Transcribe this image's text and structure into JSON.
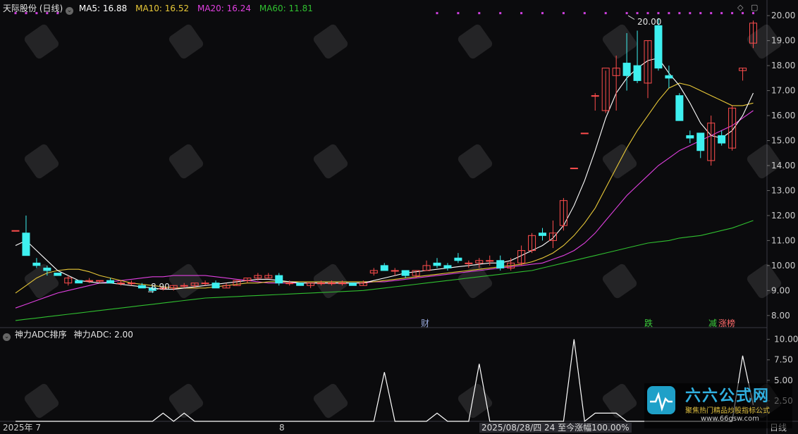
{
  "header": {
    "title": "天际股份 (日线)",
    "ma5": "MA5: 16.88",
    "ma10": "MA10: 16.52",
    "ma20": "MA20: 16.24",
    "ma60": "MA60: 11.81"
  },
  "sub_header": {
    "title": "神力ADC排序",
    "value": "神力ADC: 2.00"
  },
  "annotations": {
    "high_label": "20.00",
    "low_label": "8.90",
    "marker_cai": "财",
    "marker_die": "跌",
    "marker_jian": "减",
    "marker_zhangbang": "涨榜"
  },
  "footer": {
    "x_start": "2025年 7",
    "x_mid": "8",
    "status": "2025/08/28/四 24 至今涨幅100.00%",
    "period": "日线"
  },
  "watermark": {
    "brand": "六六公式网",
    "slogan": "聚焦热门精品炒股指标公式",
    "url": "www.66gsw.com"
  },
  "colors": {
    "up": "#ff4d4d",
    "down": "#3ef0f0",
    "ma5": "#ffffff",
    "ma10": "#e8c838",
    "ma20": "#e040e0",
    "ma60": "#30c030",
    "background": "#0b0b0d"
  },
  "chart_data": [
    {
      "type": "candlestick",
      "title": "天际股份 (日线)",
      "ylim": [
        7.6,
        20.4
      ],
      "yticks": [
        "20.00",
        "19.00",
        "18.00",
        "17.00",
        "16.00",
        "15.00",
        "14.00",
        "13.00",
        "12.00",
        "11.00",
        "10.00",
        "9.00",
        "8.00"
      ],
      "candles": [
        [
          11.4,
          11.4,
          11.4,
          11.4
        ],
        [
          11.3,
          12.0,
          10.5,
          10.4
        ],
        [
          10.1,
          10.3,
          9.9,
          10.0
        ],
        [
          9.9,
          10.0,
          9.6,
          9.8
        ],
        [
          9.7,
          9.7,
          9.6,
          9.6
        ],
        [
          9.3,
          9.6,
          9.2,
          9.5
        ],
        [
          9.4,
          9.4,
          9.3,
          9.3
        ],
        [
          9.4,
          9.5,
          9.3,
          9.4
        ],
        [
          9.4,
          9.4,
          9.3,
          9.4
        ],
        [
          9.4,
          9.5,
          9.3,
          9.3
        ],
        [
          9.3,
          9.4,
          9.2,
          9.3
        ],
        [
          9.3,
          9.4,
          9.2,
          9.3
        ],
        [
          9.2,
          9.3,
          9.1,
          9.1
        ],
        [
          9.1,
          9.2,
          8.9,
          9.0
        ],
        [
          9.1,
          9.2,
          9.0,
          9.1
        ],
        [
          9.1,
          9.2,
          9.0,
          9.2
        ],
        [
          9.2,
          9.3,
          9.1,
          9.2
        ],
        [
          9.2,
          9.3,
          9.1,
          9.3
        ],
        [
          9.3,
          9.4,
          9.2,
          9.3
        ],
        [
          9.3,
          9.4,
          9.1,
          9.1
        ],
        [
          9.1,
          9.3,
          9.1,
          9.2
        ],
        [
          9.2,
          9.4,
          9.2,
          9.4
        ],
        [
          9.4,
          9.5,
          9.3,
          9.5
        ],
        [
          9.5,
          9.7,
          9.4,
          9.6
        ],
        [
          9.5,
          9.7,
          9.5,
          9.6
        ],
        [
          9.6,
          9.7,
          9.2,
          9.3
        ],
        [
          9.3,
          9.4,
          9.2,
          9.3
        ],
        [
          9.3,
          9.3,
          9.2,
          9.2
        ],
        [
          9.2,
          9.3,
          9.1,
          9.3
        ],
        [
          9.3,
          9.4,
          9.2,
          9.3
        ],
        [
          9.3,
          9.4,
          9.2,
          9.3
        ],
        [
          9.3,
          9.4,
          9.2,
          9.3
        ],
        [
          9.3,
          9.3,
          9.2,
          9.2
        ],
        [
          9.2,
          9.4,
          9.2,
          9.3
        ],
        [
          9.7,
          9.9,
          9.6,
          9.8
        ],
        [
          10.0,
          10.1,
          9.8,
          9.8
        ],
        [
          9.8,
          9.9,
          9.6,
          9.8
        ],
        [
          9.8,
          9.8,
          9.5,
          9.6
        ],
        [
          9.6,
          9.8,
          9.5,
          9.8
        ],
        [
          9.8,
          10.2,
          9.8,
          10.0
        ],
        [
          10.1,
          10.3,
          9.9,
          10.0
        ],
        [
          10.0,
          10.1,
          9.8,
          9.9
        ],
        [
          10.3,
          10.5,
          10.1,
          10.2
        ],
        [
          10.1,
          10.2,
          9.9,
          10.1
        ],
        [
          10.1,
          10.3,
          9.9,
          10.2
        ],
        [
          10.2,
          10.4,
          10.0,
          10.2
        ],
        [
          10.2,
          10.4,
          9.8,
          9.9
        ],
        [
          9.9,
          10.3,
          9.8,
          10.1
        ],
        [
          10.1,
          10.8,
          10.0,
          10.6
        ],
        [
          10.6,
          11.3,
          10.5,
          11.2
        ],
        [
          11.3,
          11.5,
          11.0,
          11.2
        ],
        [
          11.0,
          11.8,
          10.7,
          11.3
        ],
        [
          11.6,
          12.7,
          11.4,
          12.6
        ],
        [
          13.9,
          13.9,
          13.9,
          13.9
        ],
        [
          15.3,
          15.3,
          15.3,
          15.3
        ],
        [
          16.8,
          16.9,
          16.2,
          16.8
        ],
        [
          16.2,
          17.8,
          16.1,
          17.9
        ],
        [
          17.6,
          18.4,
          16.2,
          17.9
        ],
        [
          18.1,
          19.3,
          17.0,
          17.6
        ],
        [
          18.0,
          19.4,
          17.3,
          17.4
        ],
        [
          17.3,
          19.0,
          16.7,
          19.0
        ],
        [
          19.6,
          19.9,
          17.8,
          17.9
        ],
        [
          17.6,
          18.0,
          17.1,
          17.5
        ],
        [
          16.8,
          16.9,
          15.8,
          15.8
        ],
        [
          15.2,
          15.4,
          14.9,
          15.1
        ],
        [
          15.3,
          15.3,
          14.3,
          14.6
        ],
        [
          14.2,
          16.0,
          14.0,
          15.7
        ],
        [
          15.2,
          15.4,
          14.8,
          14.9
        ],
        [
          14.7,
          16.4,
          14.6,
          16.3
        ],
        [
          17.8,
          17.9,
          17.4,
          17.9
        ],
        [
          18.9,
          19.8,
          18.7,
          19.7
        ]
      ],
      "ma5": [
        10.8,
        11.0,
        10.6,
        10.2,
        9.8,
        9.6,
        9.4,
        9.35,
        9.3,
        9.3,
        9.25,
        9.2,
        9.15,
        9.1,
        9.05,
        9.05,
        9.1,
        9.15,
        9.2,
        9.25,
        9.3,
        9.35,
        9.4,
        9.45,
        9.45,
        9.4,
        9.35,
        9.3,
        9.3,
        9.3,
        9.3,
        9.3,
        9.3,
        9.3,
        9.4,
        9.5,
        9.6,
        9.7,
        9.75,
        9.8,
        9.85,
        9.9,
        9.95,
        10.0,
        10.05,
        10.1,
        10.1,
        10.2,
        10.4,
        10.6,
        10.8,
        11.1,
        11.6,
        12.4,
        13.4,
        14.6,
        15.9,
        16.9,
        17.5,
        17.9,
        18.2,
        18.3,
        17.7,
        17.2,
        16.5,
        15.7,
        15.2,
        15.1,
        15.4,
        16.0,
        16.9
      ],
      "ma10": [
        8.9,
        9.2,
        9.5,
        9.7,
        9.8,
        9.85,
        9.85,
        9.75,
        9.6,
        9.5,
        9.4,
        9.3,
        9.25,
        9.2,
        9.15,
        9.1,
        9.1,
        9.1,
        9.1,
        9.15,
        9.2,
        9.25,
        9.3,
        9.3,
        9.35,
        9.35,
        9.35,
        9.35,
        9.35,
        9.35,
        9.35,
        9.35,
        9.35,
        9.35,
        9.35,
        9.4,
        9.45,
        9.5,
        9.55,
        9.6,
        9.65,
        9.7,
        9.75,
        9.8,
        9.85,
        9.9,
        9.95,
        10.0,
        10.05,
        10.15,
        10.3,
        10.5,
        10.8,
        11.2,
        11.7,
        12.3,
        13.1,
        13.9,
        14.7,
        15.4,
        16.0,
        16.6,
        17.1,
        17.3,
        17.2,
        17.0,
        16.8,
        16.6,
        16.4,
        16.4,
        16.5
      ],
      "ma20": [
        8.3,
        8.45,
        8.6,
        8.75,
        8.9,
        9.0,
        9.1,
        9.2,
        9.3,
        9.35,
        9.4,
        9.45,
        9.5,
        9.55,
        9.55,
        9.6,
        9.6,
        9.6,
        9.6,
        9.55,
        9.5,
        9.45,
        9.4,
        9.35,
        9.3,
        9.3,
        9.3,
        9.3,
        9.3,
        9.3,
        9.3,
        9.3,
        9.3,
        9.3,
        9.35,
        9.35,
        9.4,
        9.45,
        9.5,
        9.55,
        9.6,
        9.65,
        9.7,
        9.75,
        9.8,
        9.85,
        9.9,
        9.95,
        10.0,
        10.05,
        10.1,
        10.25,
        10.4,
        10.6,
        10.9,
        11.3,
        11.8,
        12.3,
        12.8,
        13.2,
        13.6,
        14.0,
        14.3,
        14.6,
        14.8,
        15.0,
        15.2,
        15.4,
        15.6,
        15.9,
        16.2
      ],
      "ma60": [
        7.8,
        7.85,
        7.9,
        7.95,
        8.0,
        8.05,
        8.1,
        8.15,
        8.2,
        8.25,
        8.3,
        8.35,
        8.4,
        8.45,
        8.5,
        8.55,
        8.6,
        8.65,
        8.7,
        8.72,
        8.74,
        8.76,
        8.78,
        8.8,
        8.82,
        8.84,
        8.86,
        8.88,
        8.9,
        8.92,
        8.94,
        8.96,
        8.98,
        9.0,
        9.05,
        9.1,
        9.15,
        9.2,
        9.25,
        9.3,
        9.35,
        9.4,
        9.45,
        9.5,
        9.55,
        9.6,
        9.65,
        9.7,
        9.75,
        9.8,
        9.9,
        10.0,
        10.1,
        10.2,
        10.3,
        10.4,
        10.5,
        10.6,
        10.7,
        10.8,
        10.9,
        10.95,
        11.0,
        11.1,
        11.15,
        11.2,
        11.3,
        11.4,
        11.5,
        11.65,
        11.8
      ],
      "signal_dots_price": 20.1
    },
    {
      "type": "line",
      "title": "神力ADC排序",
      "ylim": [
        0,
        11
      ],
      "yticks": [
        "10.00",
        "7.50",
        "5.00",
        "2.50"
      ],
      "series": [
        {
          "name": "神力ADC",
          "values": [
            0,
            0,
            0,
            0,
            0,
            0,
            0,
            0,
            0,
            0,
            0,
            0,
            0,
            0,
            1,
            0,
            1,
            0,
            0,
            0,
            0,
            0,
            0,
            0,
            0,
            0,
            0,
            0,
            0,
            0,
            0,
            0,
            0,
            0,
            0,
            6,
            0,
            0,
            0,
            0,
            1,
            0,
            0,
            0,
            7,
            0,
            0,
            0,
            0,
            0,
            0,
            0,
            0,
            10,
            0,
            1,
            1,
            1,
            0,
            0,
            0,
            0,
            0,
            0,
            0,
            0,
            0,
            0,
            0,
            8,
            2
          ]
        }
      ]
    }
  ]
}
